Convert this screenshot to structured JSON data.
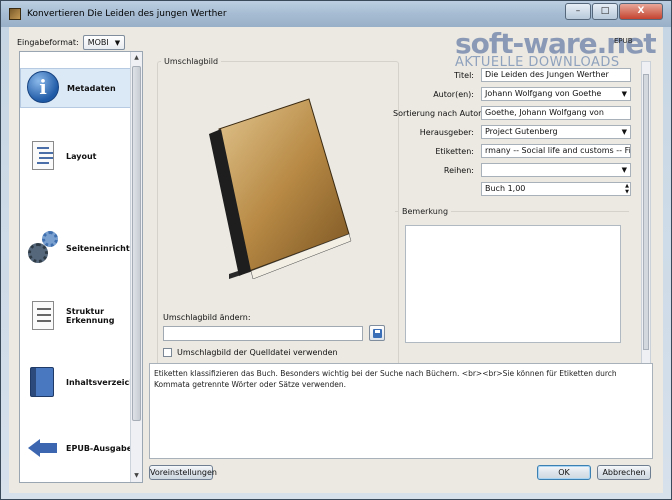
{
  "window": {
    "title": "Konvertieren Die Leiden des jungen Werther",
    "controls": {
      "minimize": "–",
      "maximize": "□",
      "close": "X"
    }
  },
  "watermark": {
    "brand": "soft-ware.net",
    "subtitle": "AKTUELLE DOWNLOADS",
    "format_tag": "EPUB"
  },
  "format": {
    "label": "Eingabeformat:",
    "value": "MOBI"
  },
  "sidebar": {
    "items": [
      {
        "label": "Metadaten",
        "icon": "info-icon"
      },
      {
        "label": "Layout",
        "icon": "layout-icon"
      },
      {
        "label": "Seiteneinrichtung",
        "icon": "gears-icon"
      },
      {
        "label": "Struktur Erkennung",
        "line1": "Struktur",
        "line2": "Erkennung",
        "icon": "document-icon"
      },
      {
        "label": "Inhaltsverzeichnis",
        "icon": "book-icon"
      },
      {
        "label": "EPUB-Ausgabe",
        "icon": "arrow-left-icon"
      }
    ]
  },
  "cover": {
    "group_title": "Umschlagbild",
    "change_label": "Umschlagbild ändern:",
    "path_value": "",
    "use_source_label": "Umschlagbild der Quelldatei verwenden"
  },
  "metadata": {
    "title_label": "Titel:",
    "title_value": "Die Leiden des Jungen Werther",
    "author_label": "Autor(en):",
    "author_value": "Johann Wolfgang von Goethe",
    "sort_label": "Sortierung nach Autor:",
    "sort_value": "Goethe, Johann Wolfgang von",
    "publisher_label": "Herausgeber:",
    "publisher_value": "Project Gutenberg",
    "tags_label": "Etiketten:",
    "tags_value": "rmany -- Social life and customs -- Fiction",
    "series_label": "Reihen:",
    "series_value": "",
    "series_index_value": "Buch 1,00",
    "comment_label": "Bemerkung",
    "comment_value": ""
  },
  "help": {
    "text": "Etiketten klassifizieren das Buch. Besonders wichtig bei der Suche nach Büchern. <br><br>Sie können für Etiketten durch Kommata getrennte Wörter oder Sätze verwenden."
  },
  "buttons": {
    "defaults": "Voreinstellungen",
    "ok": "OK",
    "cancel": "Abbrechen"
  },
  "colors": {
    "accent": "#3c7fb1",
    "sidebar_active": "#dbe8f6"
  }
}
